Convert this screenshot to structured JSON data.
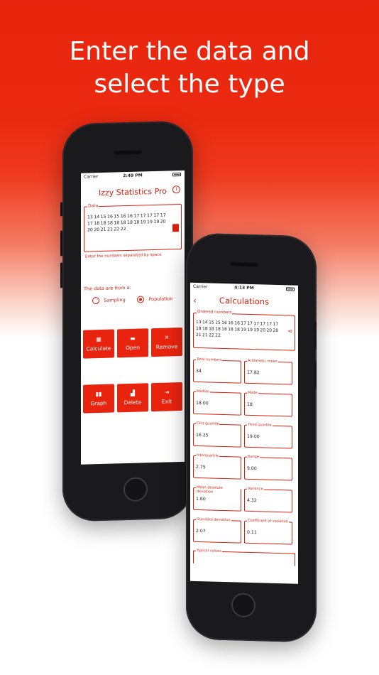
{
  "headline": {
    "line1": "Enter the data and",
    "line2": "select the type"
  },
  "phone1": {
    "status": {
      "carrier": "Carrier",
      "time": "2:49 PM"
    },
    "app_title": "Izzy Statistics Pro",
    "info_icon": "i",
    "data_legend": "Data",
    "data_text": "13 14 15 16 15 16 16 17 17 17 17 17 17 18 18 18 18 18 18 18 19 19 19 20 20 20 21 21 22 22",
    "hint": "Enter the numbers separated by space",
    "type_label": "The data are from a:",
    "radios": [
      {
        "label": "Sampling",
        "selected": false
      },
      {
        "label": "Population",
        "selected": true
      }
    ],
    "buttons_row1": [
      {
        "label": "Calculate",
        "icon": "calculator-icon"
      },
      {
        "label": "Open",
        "icon": "folder-icon"
      },
      {
        "label": "Remove",
        "icon": "close-icon"
      }
    ],
    "buttons_row2": [
      {
        "label": "Graph",
        "icon": "bar-chart-icon"
      },
      {
        "label": "Delete",
        "icon": "trash-icon"
      },
      {
        "label": "Exit",
        "icon": "exit-icon"
      }
    ],
    "accent": "#e8240e"
  },
  "phone2": {
    "status": {
      "carrier": "Carrier",
      "time": "4:13 PM"
    },
    "title": "Calculations",
    "ordered_legend": "Ordered numbers",
    "ordered_text": "13 14 15 15 16 16 16 17 17 17 17 17 17 18 18 18 18 18 18 18 19 19 19 20 20 20 21 21 22 22",
    "stats": [
      {
        "label": "Total numbers",
        "value": "34"
      },
      {
        "label": "Arithmetic mean",
        "value": "17.82"
      },
      {
        "label": "Median",
        "value": "18.00"
      },
      {
        "label": "Mode",
        "value": "18"
      },
      {
        "label": "First quartile",
        "value": "16.25"
      },
      {
        "label": "Third quartile",
        "value": "19.00"
      },
      {
        "label": "Interquartile",
        "value": "2.75"
      },
      {
        "label": "Range",
        "value": "9.00"
      },
      {
        "label": "Mean absolute deviation",
        "value": "1.60"
      },
      {
        "label": "Variance",
        "value": "4.32"
      },
      {
        "label": "Standard deviation",
        "value": "2.07"
      },
      {
        "label": "Coefficient of variation",
        "value": "0.11"
      }
    ],
    "typical_legend": "Typical values"
  }
}
